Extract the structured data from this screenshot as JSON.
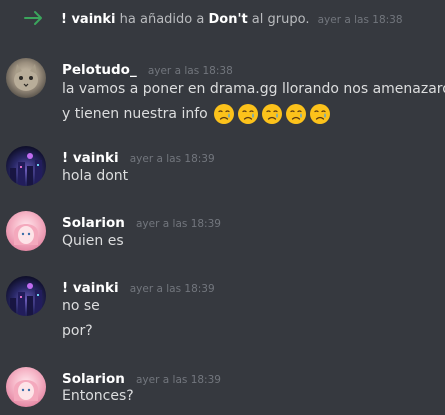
{
  "system_message": {
    "actor": "! vainki",
    "action": "ha añadido a",
    "target": "Don't",
    "suffix": "al grupo.",
    "timestamp": "ayer a las 18:38"
  },
  "messages": [
    {
      "author": "Pelotudo_",
      "timestamp": "ayer a las 18:38",
      "lines": [
        "la vamos a poner en drama.gg llorando nos amenazaron",
        "y tienen nuestra info"
      ],
      "emoji_name": "crying-face-icon",
      "emoji_count": 5
    },
    {
      "author": "! vainki",
      "timestamp": "ayer a las 18:39",
      "lines": [
        "hola dont"
      ]
    },
    {
      "author": "Solarion",
      "timestamp": "ayer a las 18:39",
      "lines": [
        "Quien es"
      ]
    },
    {
      "author": "! vainki",
      "timestamp": "ayer a las 18:39",
      "lines": [
        "no se",
        "por?"
      ]
    },
    {
      "author": "Solarion",
      "timestamp": "ayer a las 18:39",
      "lines": [
        "Entonces?"
      ]
    }
  ],
  "colors": {
    "background": "#36393f",
    "arrow": "#3ba55c",
    "author": "#ffffff",
    "timestamp": "#72767d",
    "text": "#dcddde"
  }
}
